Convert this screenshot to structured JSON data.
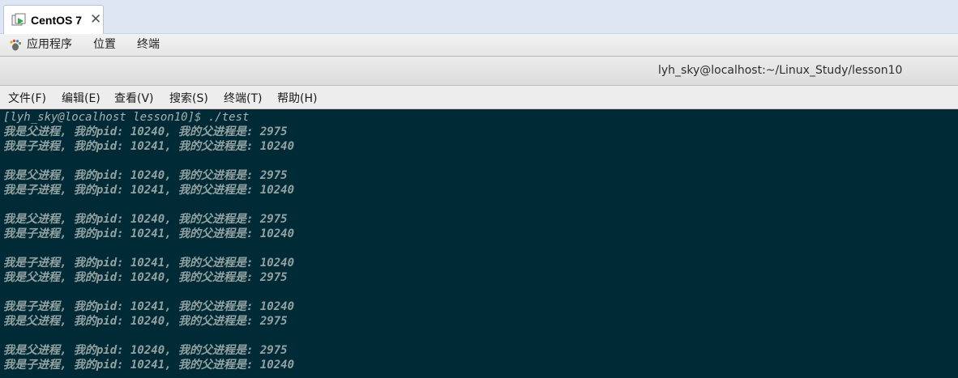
{
  "vm_tab": {
    "title": "CentOS 7",
    "close_glyph": "✕",
    "icon": "vm-icon"
  },
  "gnome_bar": {
    "applications": "应用程序",
    "places": "位置",
    "terminal": "终端",
    "apps_icon": "gnome-foot-icon"
  },
  "window": {
    "title": "lyh_sky@localhost:~/Linux_Study/lesson10"
  },
  "menu": [
    {
      "label": "文件(F)"
    },
    {
      "label": "编辑(E)"
    },
    {
      "label": "查看(V)"
    },
    {
      "label": "搜索(S)"
    },
    {
      "label": "终端(T)"
    },
    {
      "label": "帮助(H)"
    }
  ],
  "terminal": {
    "background": "#002b36",
    "foreground": "#93a1a1",
    "prompt": "[lyh_sky@localhost lesson10]$ ./test",
    "lines": [
      "我是父进程, 我的pid: 10240, 我的父进程是: 2975",
      "我是子进程, 我的pid: 10241, 我的父进程是: 10240",
      "",
      "我是父进程, 我的pid: 10240, 我的父进程是: 2975",
      "我是子进程, 我的pid: 10241, 我的父进程是: 10240",
      "",
      "我是父进程, 我的pid: 10240, 我的父进程是: 2975",
      "我是子进程, 我的pid: 10241, 我的父进程是: 10240",
      "",
      "我是子进程, 我的pid: 10241, 我的父进程是: 10240",
      "我是父进程, 我的pid: 10240, 我的父进程是: 2975",
      "",
      "我是子进程, 我的pid: 10241, 我的父进程是: 10240",
      "我是父进程, 我的pid: 10240, 我的父进程是: 2975",
      "",
      "我是父进程, 我的pid: 10240, 我的父进程是: 2975",
      "我是子进程, 我的pid: 10241, 我的父进程是: 10240"
    ]
  }
}
